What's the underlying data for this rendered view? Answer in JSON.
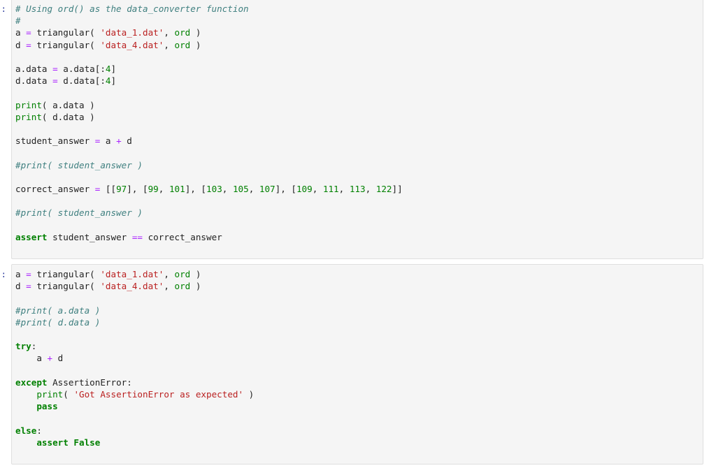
{
  "notebook": {
    "cells": [
      {
        "prompt": ":",
        "kind": "code",
        "lines": [
          [
            {
              "t": "# Using ord() as the data_converter function",
              "c": "comment"
            }
          ],
          [
            {
              "t": "#",
              "c": "comment"
            }
          ],
          [
            {
              "t": "a ",
              "c": "plain"
            },
            {
              "t": "=",
              "c": "operator"
            },
            {
              "t": " triangular( ",
              "c": "plain"
            },
            {
              "t": "'data_1.dat'",
              "c": "string"
            },
            {
              "t": ", ",
              "c": "plain"
            },
            {
              "t": "ord",
              "c": "builtin"
            },
            {
              "t": " )",
              "c": "plain"
            }
          ],
          [
            {
              "t": "d ",
              "c": "plain"
            },
            {
              "t": "=",
              "c": "operator"
            },
            {
              "t": " triangular( ",
              "c": "plain"
            },
            {
              "t": "'data_4.dat'",
              "c": "string"
            },
            {
              "t": ", ",
              "c": "plain"
            },
            {
              "t": "ord",
              "c": "builtin"
            },
            {
              "t": " )",
              "c": "plain"
            }
          ],
          [
            {
              "t": "",
              "c": "plain"
            }
          ],
          [
            {
              "t": "a.data ",
              "c": "plain"
            },
            {
              "t": "=",
              "c": "operator"
            },
            {
              "t": " a.data[:",
              "c": "plain"
            },
            {
              "t": "4",
              "c": "number"
            },
            {
              "t": "]",
              "c": "plain"
            }
          ],
          [
            {
              "t": "d.data ",
              "c": "plain"
            },
            {
              "t": "=",
              "c": "operator"
            },
            {
              "t": " d.data[:",
              "c": "plain"
            },
            {
              "t": "4",
              "c": "number"
            },
            {
              "t": "]",
              "c": "plain"
            }
          ],
          [
            {
              "t": "",
              "c": "plain"
            }
          ],
          [
            {
              "t": "print",
              "c": "builtin"
            },
            {
              "t": "( a.data )",
              "c": "plain"
            }
          ],
          [
            {
              "t": "print",
              "c": "builtin"
            },
            {
              "t": "( d.data )",
              "c": "plain"
            }
          ],
          [
            {
              "t": "",
              "c": "plain"
            }
          ],
          [
            {
              "t": "student_answer ",
              "c": "plain"
            },
            {
              "t": "=",
              "c": "operator"
            },
            {
              "t": " a ",
              "c": "plain"
            },
            {
              "t": "+",
              "c": "operator"
            },
            {
              "t": " d",
              "c": "plain"
            }
          ],
          [
            {
              "t": "",
              "c": "plain"
            }
          ],
          [
            {
              "t": "#print( student_answer )",
              "c": "comment"
            }
          ],
          [
            {
              "t": "",
              "c": "plain"
            }
          ],
          [
            {
              "t": "correct_answer ",
              "c": "plain"
            },
            {
              "t": "=",
              "c": "operator"
            },
            {
              "t": " [[",
              "c": "plain"
            },
            {
              "t": "97",
              "c": "number"
            },
            {
              "t": "], [",
              "c": "plain"
            },
            {
              "t": "99",
              "c": "number"
            },
            {
              "t": ", ",
              "c": "plain"
            },
            {
              "t": "101",
              "c": "number"
            },
            {
              "t": "], [",
              "c": "plain"
            },
            {
              "t": "103",
              "c": "number"
            },
            {
              "t": ", ",
              "c": "plain"
            },
            {
              "t": "105",
              "c": "number"
            },
            {
              "t": ", ",
              "c": "plain"
            },
            {
              "t": "107",
              "c": "number"
            },
            {
              "t": "], [",
              "c": "plain"
            },
            {
              "t": "109",
              "c": "number"
            },
            {
              "t": ", ",
              "c": "plain"
            },
            {
              "t": "111",
              "c": "number"
            },
            {
              "t": ", ",
              "c": "plain"
            },
            {
              "t": "113",
              "c": "number"
            },
            {
              "t": ", ",
              "c": "plain"
            },
            {
              "t": "122",
              "c": "number"
            },
            {
              "t": "]]",
              "c": "plain"
            }
          ],
          [
            {
              "t": "",
              "c": "plain"
            }
          ],
          [
            {
              "t": "#print( student_answer )",
              "c": "comment"
            }
          ],
          [
            {
              "t": "",
              "c": "plain"
            }
          ],
          [
            {
              "t": "assert",
              "c": "keyword"
            },
            {
              "t": " student_answer ",
              "c": "plain"
            },
            {
              "t": "==",
              "c": "operator"
            },
            {
              "t": " correct_answer",
              "c": "plain"
            }
          ],
          [
            {
              "t": "",
              "c": "plain"
            }
          ]
        ]
      },
      {
        "prompt": ":",
        "kind": "code",
        "lines": [
          [
            {
              "t": "a ",
              "c": "plain"
            },
            {
              "t": "=",
              "c": "operator"
            },
            {
              "t": " triangular( ",
              "c": "plain"
            },
            {
              "t": "'data_1.dat'",
              "c": "string"
            },
            {
              "t": ", ",
              "c": "plain"
            },
            {
              "t": "ord",
              "c": "builtin"
            },
            {
              "t": " )",
              "c": "plain"
            }
          ],
          [
            {
              "t": "d ",
              "c": "plain"
            },
            {
              "t": "=",
              "c": "operator"
            },
            {
              "t": " triangular( ",
              "c": "plain"
            },
            {
              "t": "'data_4.dat'",
              "c": "string"
            },
            {
              "t": ", ",
              "c": "plain"
            },
            {
              "t": "ord",
              "c": "builtin"
            },
            {
              "t": " )",
              "c": "plain"
            }
          ],
          [
            {
              "t": "",
              "c": "plain"
            }
          ],
          [
            {
              "t": "#print( a.data )",
              "c": "comment"
            }
          ],
          [
            {
              "t": "#print( d.data )",
              "c": "comment"
            }
          ],
          [
            {
              "t": "",
              "c": "plain"
            }
          ],
          [
            {
              "t": "try",
              "c": "keyword"
            },
            {
              "t": ":",
              "c": "plain"
            }
          ],
          [
            {
              "t": "    a ",
              "c": "plain"
            },
            {
              "t": "+",
              "c": "operator"
            },
            {
              "t": " d",
              "c": "plain"
            }
          ],
          [
            {
              "t": "",
              "c": "plain"
            }
          ],
          [
            {
              "t": "except",
              "c": "keyword"
            },
            {
              "t": " AssertionError:",
              "c": "plain"
            }
          ],
          [
            {
              "t": "    ",
              "c": "plain"
            },
            {
              "t": "print",
              "c": "builtin"
            },
            {
              "t": "( ",
              "c": "plain"
            },
            {
              "t": "'Got AssertionError as expected'",
              "c": "string"
            },
            {
              "t": " )",
              "c": "plain"
            }
          ],
          [
            {
              "t": "    ",
              "c": "plain"
            },
            {
              "t": "pass",
              "c": "keyword"
            }
          ],
          [
            {
              "t": "",
              "c": "plain"
            }
          ],
          [
            {
              "t": "else",
              "c": "keyword"
            },
            {
              "t": ":",
              "c": "plain"
            }
          ],
          [
            {
              "t": "    ",
              "c": "plain"
            },
            {
              "t": "assert False",
              "c": "keyword"
            }
          ],
          [
            {
              "t": "",
              "c": "plain"
            }
          ]
        ]
      }
    ]
  },
  "colors": {
    "cell_background": "#f5f5f5",
    "cell_border": "#dfdfdf",
    "prompt": "#303F9F",
    "comment": "#408080",
    "string": "#BA2121",
    "number": "#008000",
    "keyword": "#008000",
    "builtin": "#008000",
    "operator": "#AA22FF",
    "plain": "#222222",
    "page_background": "#ffffff"
  }
}
